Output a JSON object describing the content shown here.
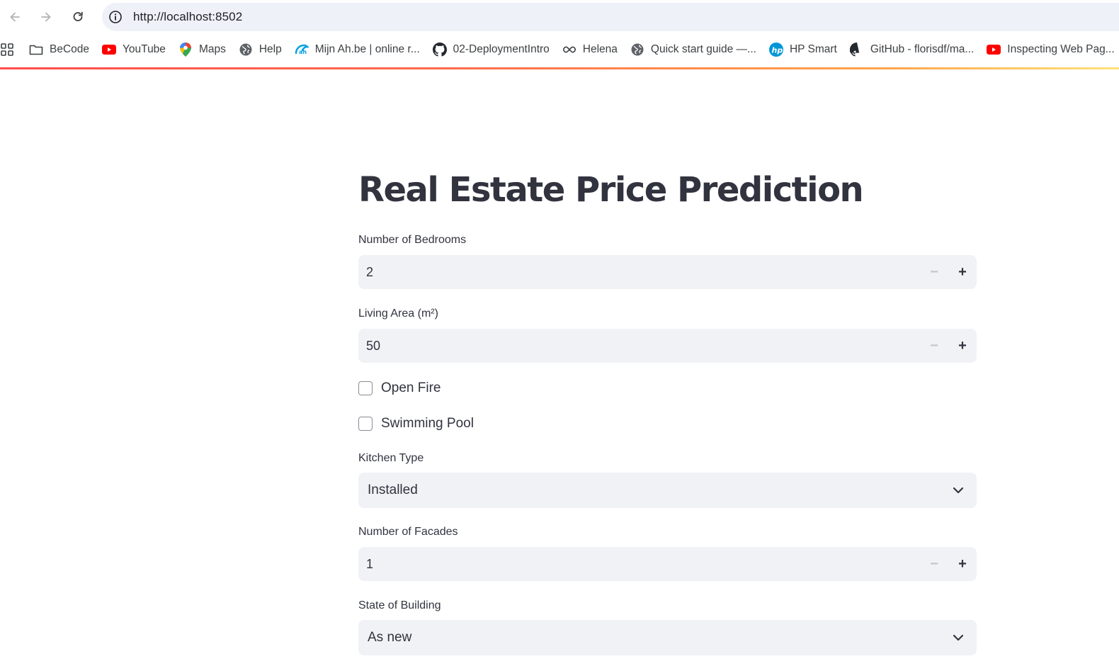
{
  "browser": {
    "url": "http://localhost:8502",
    "bookmarks": [
      {
        "label": "BeCode",
        "icon": "folder-icon"
      },
      {
        "label": "YouTube",
        "icon": "youtube-icon"
      },
      {
        "label": "Maps",
        "icon": "maps-pin-icon"
      },
      {
        "label": "Help",
        "icon": "globe-icon"
      },
      {
        "label": "Mijn Ah.be | online r...",
        "icon": "ah-icon"
      },
      {
        "label": "02-DeploymentIntro",
        "icon": "github-icon"
      },
      {
        "label": "Helena",
        "icon": "infinity-icon"
      },
      {
        "label": "Quick start guide —...",
        "icon": "globe-icon"
      },
      {
        "label": "HP Smart",
        "icon": "hp-icon"
      },
      {
        "label": "GitHub - florisdf/ma...",
        "icon": "github-icon"
      },
      {
        "label": "Inspecting Web Pag...",
        "icon": "youtube-icon"
      }
    ]
  },
  "app": {
    "title": "Real Estate Price Prediction",
    "bedrooms": {
      "label": "Number of Bedrooms",
      "value": "2",
      "minus": "−",
      "plus": "+"
    },
    "living_area": {
      "label": "Living Area (m²)",
      "value": "50",
      "minus": "−",
      "plus": "+"
    },
    "open_fire": {
      "label": "Open Fire",
      "checked": false
    },
    "swimming_pool": {
      "label": "Swimming Pool",
      "checked": false
    },
    "kitchen_type": {
      "label": "Kitchen Type",
      "value": "Installed"
    },
    "facades": {
      "label": "Number of Facades",
      "value": "1",
      "minus": "−",
      "plus": "+"
    },
    "state_of_building": {
      "label": "State of Building",
      "value": "As new"
    }
  },
  "colors": {
    "accent": "#ff4b4b",
    "input_bg": "#f0f2f6",
    "text": "#31333f"
  }
}
